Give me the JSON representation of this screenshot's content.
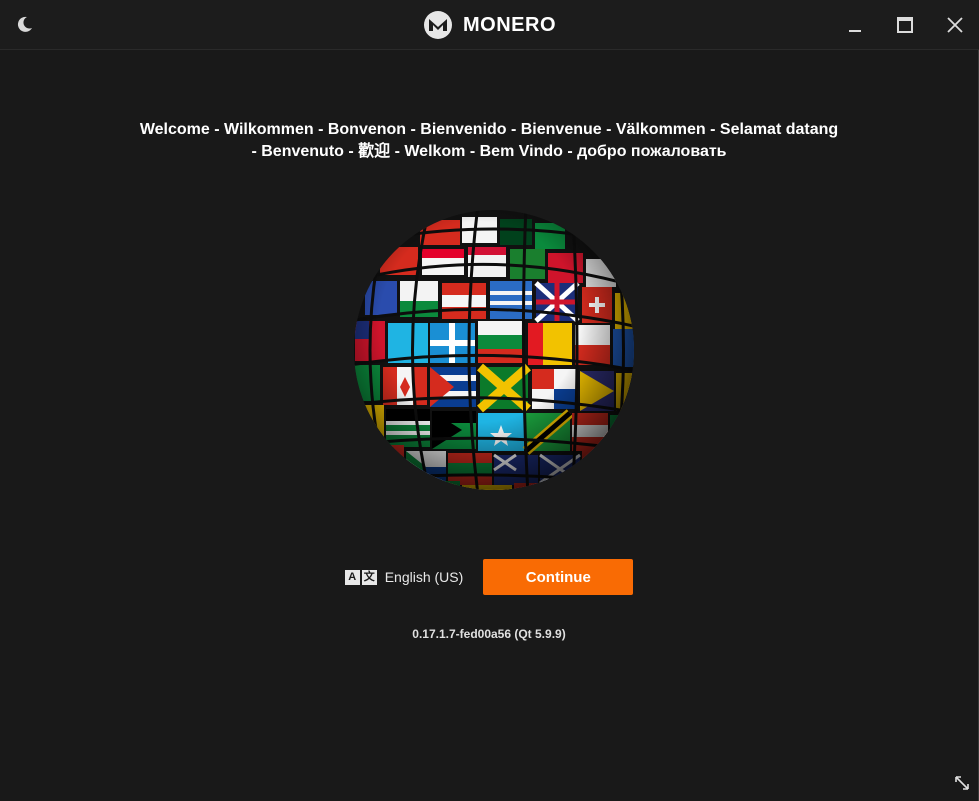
{
  "window": {
    "app_name": "MONERO"
  },
  "icons": {
    "theme": "moon-icon",
    "logo": "monero-logo-icon",
    "minimize": "minimize-icon",
    "maximize": "maximize-icon",
    "close": "close-icon",
    "language": "translate-icon",
    "resize": "resize-icon",
    "globe": "flags-globe-image"
  },
  "welcome": {
    "line1": "Welcome - Wilkommen - Bonvenon - Bienvenido - Bienvenue - Välkommen - Selamat datang",
    "line2": "- Benvenuto - 歡迎 - Welkom - Bem Vindo - добро пожаловать"
  },
  "language": {
    "icon_left": "A",
    "icon_right": "文",
    "selected": "English (US)"
  },
  "actions": {
    "continue_label": "Continue"
  },
  "version": "0.17.1.7-fed00a56 (Qt 5.9.9)",
  "colors": {
    "accent": "#f96b04",
    "background": "#191919",
    "text": "#ffffff"
  }
}
